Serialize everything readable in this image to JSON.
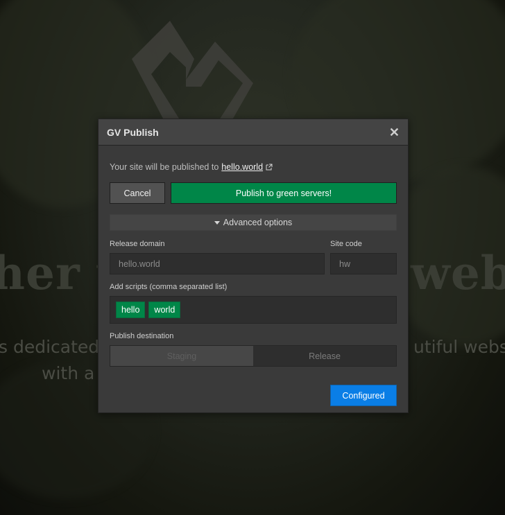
{
  "background": {
    "heading_left": "her w",
    "heading_right": "web",
    "subtext_left": "s dedicated",
    "subtext_left2": "with a",
    "subtext_right": "utiful webs"
  },
  "modal": {
    "title": "GV Publish",
    "close_icon": "close-icon",
    "published_prefix": "Your site will be published to",
    "published_domain": "hello.world",
    "cancel_label": "Cancel",
    "publish_label": "Publish to green servers!",
    "advanced_label": "Advanced options",
    "release_domain": {
      "label": "Release domain",
      "placeholder": "hello.world"
    },
    "site_code": {
      "label": "Site code",
      "placeholder": "hw"
    },
    "scripts": {
      "label": "Add scripts (comma separated list)",
      "tags": [
        "hello",
        "world"
      ]
    },
    "destination": {
      "label": "Publish destination",
      "options": [
        "Staging",
        "Release"
      ]
    },
    "configured_label": "Configured"
  },
  "colors": {
    "publish_green": "#008648",
    "configured_blue": "#0a7ee6",
    "modal_bg": "#3a3a3a"
  }
}
